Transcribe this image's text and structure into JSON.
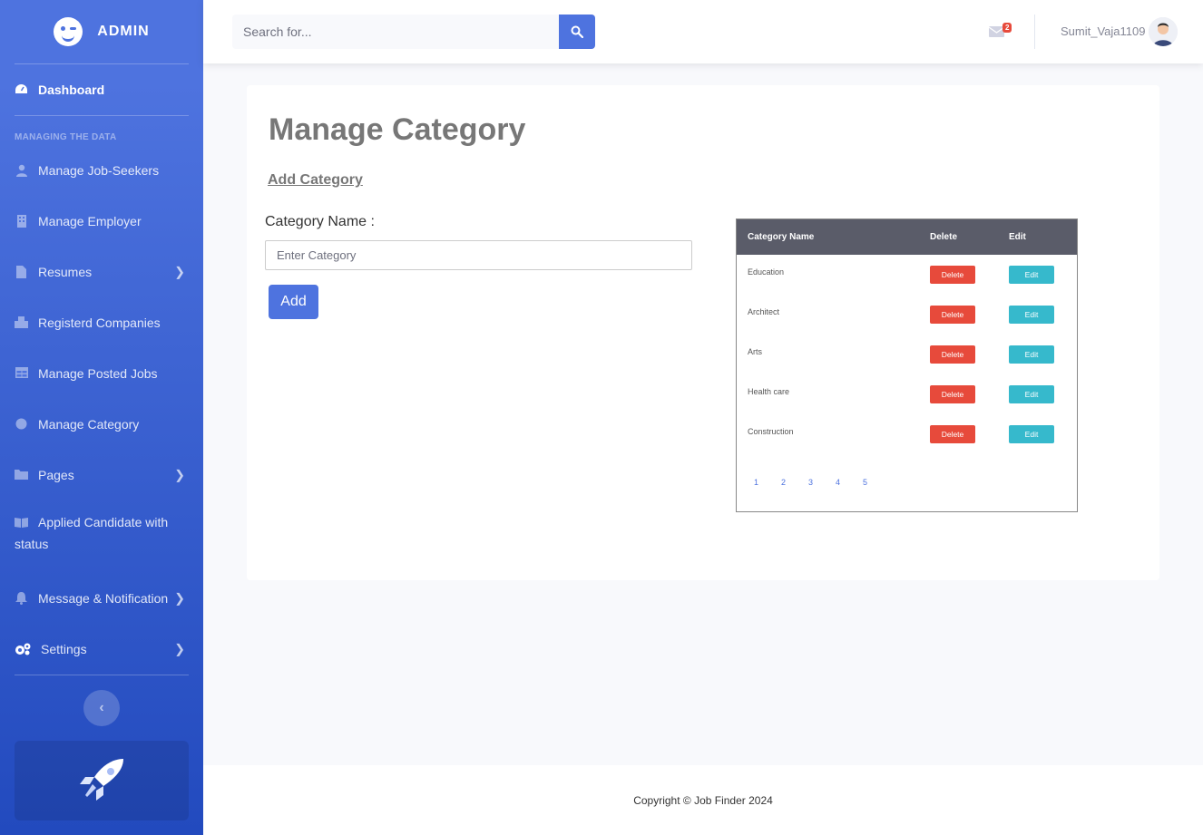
{
  "brand": {
    "title": "ADMIN"
  },
  "sidebar": {
    "dashboard": "Dashboard",
    "heading": "MANAGING THE DATA",
    "items": [
      {
        "label": "Manage Job-Seekers",
        "icon": "user-icon"
      },
      {
        "label": "Manage Employer",
        "icon": "building-icon"
      },
      {
        "label": "Resumes",
        "icon": "file-icon",
        "chevron": true
      },
      {
        "label": "Registerd Companies",
        "icon": "briefcase-icon"
      },
      {
        "label": "Manage Posted Jobs",
        "icon": "table-icon"
      },
      {
        "label": "Manage Category",
        "icon": "circle-icon"
      },
      {
        "label": "Pages",
        "icon": "folder-icon",
        "chevron": true
      },
      {
        "label": "Applied Candidate with status",
        "icon": "book-icon"
      },
      {
        "label": "Message & Notification",
        "icon": "bell-icon",
        "chevron": true
      },
      {
        "label": "Settings",
        "icon": "cogs-icon",
        "chevron": true
      }
    ]
  },
  "topbar": {
    "search_placeholder": "Search for...",
    "message_count": "2",
    "username": "Sumit_Vaja1109"
  },
  "main": {
    "title": "Manage Category",
    "add_link": "Add Category",
    "field_label": "Category Name :",
    "field_placeholder": "Enter Category",
    "add_button": "Add",
    "table": {
      "headers": [
        "Category Name",
        "Delete",
        "Edit"
      ],
      "rows": [
        {
          "name": "Education",
          "delete": "Delete",
          "edit": "Edit"
        },
        {
          "name": "Architect",
          "delete": "Delete",
          "edit": "Edit"
        },
        {
          "name": "Arts",
          "delete": "Delete",
          "edit": "Edit"
        },
        {
          "name": "Health care",
          "delete": "Delete",
          "edit": "Edit"
        },
        {
          "name": "Construction",
          "delete": "Delete",
          "edit": "Edit"
        }
      ],
      "pages": [
        "1",
        "2",
        "3",
        "4",
        "5"
      ]
    }
  },
  "footer": {
    "text": "Copyright © Job Finder 2024"
  },
  "colors": {
    "primary": "#4e73df",
    "danger": "#e74a3b",
    "info": "#36b9cc",
    "header": "#5a5c69"
  }
}
